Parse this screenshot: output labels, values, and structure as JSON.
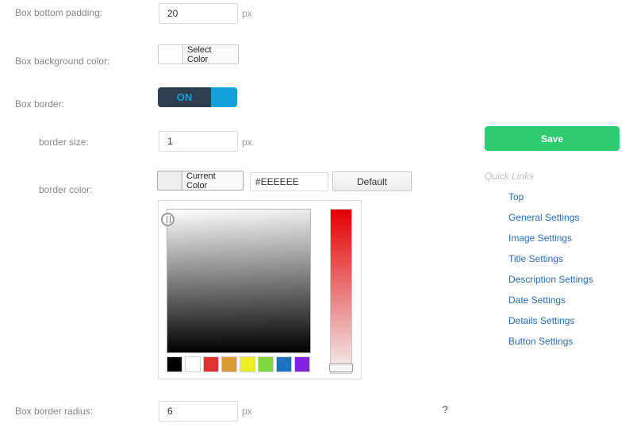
{
  "form": {
    "box_bottom_padding": {
      "label": "Box bottom padding:",
      "value": "20",
      "unit": "px"
    },
    "box_background_color": {
      "label": "Box background color:",
      "button_label": "Select Color",
      "swatch_color": "#ffffff"
    },
    "box_border": {
      "label": "Box border:",
      "toggle_label": "ON",
      "toggle_color": "#139fda"
    },
    "border_size": {
      "label": "border size:",
      "value": "1",
      "unit": "px"
    },
    "border_color": {
      "label": "border color:",
      "button_label": "Current Color",
      "current_color": "#EEEEEE",
      "hex_value": "#EEEEEE",
      "default_label": "Default",
      "palette": [
        "#000000",
        "#ffffff",
        "#dd3333",
        "#dd9933",
        "#eeee22",
        "#81d742",
        "#1e73be",
        "#8224e3"
      ]
    },
    "box_border_radius": {
      "label": "Box border radius:",
      "value": "6",
      "unit": "px",
      "help": "?"
    }
  },
  "sidebar": {
    "save_label": "Save",
    "save_color": "#2ecc71",
    "quick_links_title": "Quick Links",
    "links": [
      "Top",
      "General Settings",
      "Image Settings",
      "Title Settings",
      "Description Settings",
      "Date Settings",
      "Details Settings",
      "Button Settings"
    ]
  }
}
